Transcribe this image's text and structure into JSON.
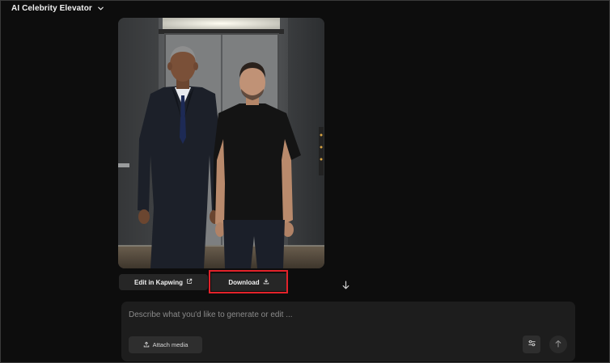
{
  "header": {
    "title": "AI Celebrity Elevator",
    "dropdown_icon": "chevron-down-icon"
  },
  "image": {
    "alt": "Generated image: two men standing in an elevator",
    "kind": "generated-photo"
  },
  "actions": {
    "edit_label": "Edit in Kapwing",
    "edit_icon": "external-link-icon",
    "download_label": "Download",
    "download_icon": "download-icon",
    "scroll_icon": "arrow-down-icon"
  },
  "composer": {
    "placeholder": "Describe what you'd like to generate or edit ...",
    "value": "",
    "attach_label": "Attach media",
    "attach_icon": "upload-icon",
    "settings_icon": "sliders-icon",
    "send_icon": "arrow-up-icon"
  },
  "colors": {
    "background": "#0d0d0d",
    "button_bg": "#262626",
    "composer_bg": "#1d1d1d",
    "highlight": "#e3222a"
  }
}
